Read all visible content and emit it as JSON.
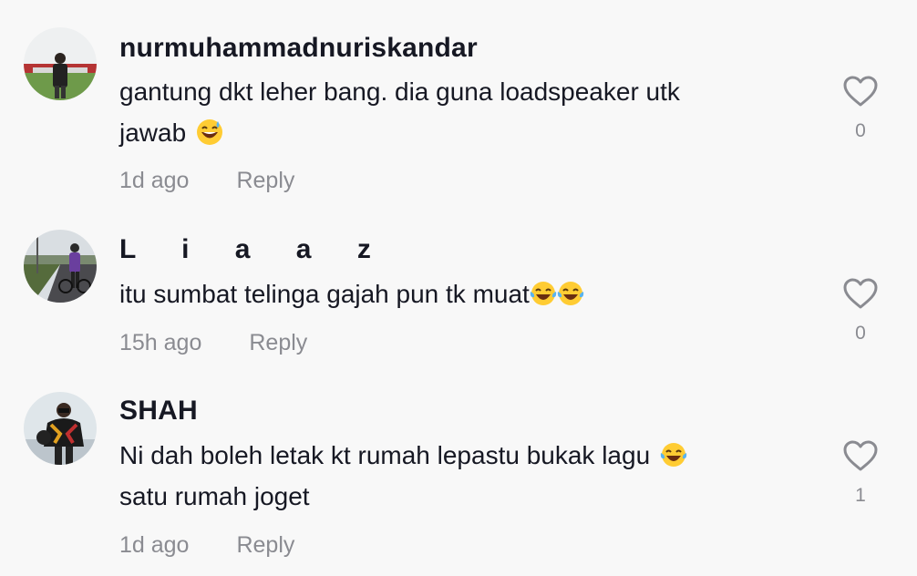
{
  "comments": [
    {
      "username": "nurmuhammadnuriskandar",
      "text_lines": [
        "gantung dkt leher bang. dia guna loadspeaker utk",
        "jawab"
      ],
      "emoji": [
        "grinning-sweat-emoji"
      ],
      "time": "1d ago",
      "reply_label": "Reply",
      "likes": "0"
    },
    {
      "username": "L i a a z",
      "text_lines": [
        "itu sumbat telinga gajah pun tk muat"
      ],
      "emoji": [
        "tears-of-joy-emoji",
        "tears-of-joy-emoji"
      ],
      "time": "15h ago",
      "reply_label": "Reply",
      "likes": "0"
    },
    {
      "username": "SHAH",
      "text_lines": [
        "Ni dah boleh letak kt rumah lepastu bukak lagu",
        "satu rumah joget"
      ],
      "emoji": [
        "tears-of-joy-emoji"
      ],
      "time": "1d ago",
      "reply_label": "Reply",
      "likes": "1"
    }
  ],
  "colors": {
    "background": "#f8f8f8",
    "text": "#161823",
    "secondary": "#8a8b91",
    "heart_outline": "#8a8b91"
  }
}
